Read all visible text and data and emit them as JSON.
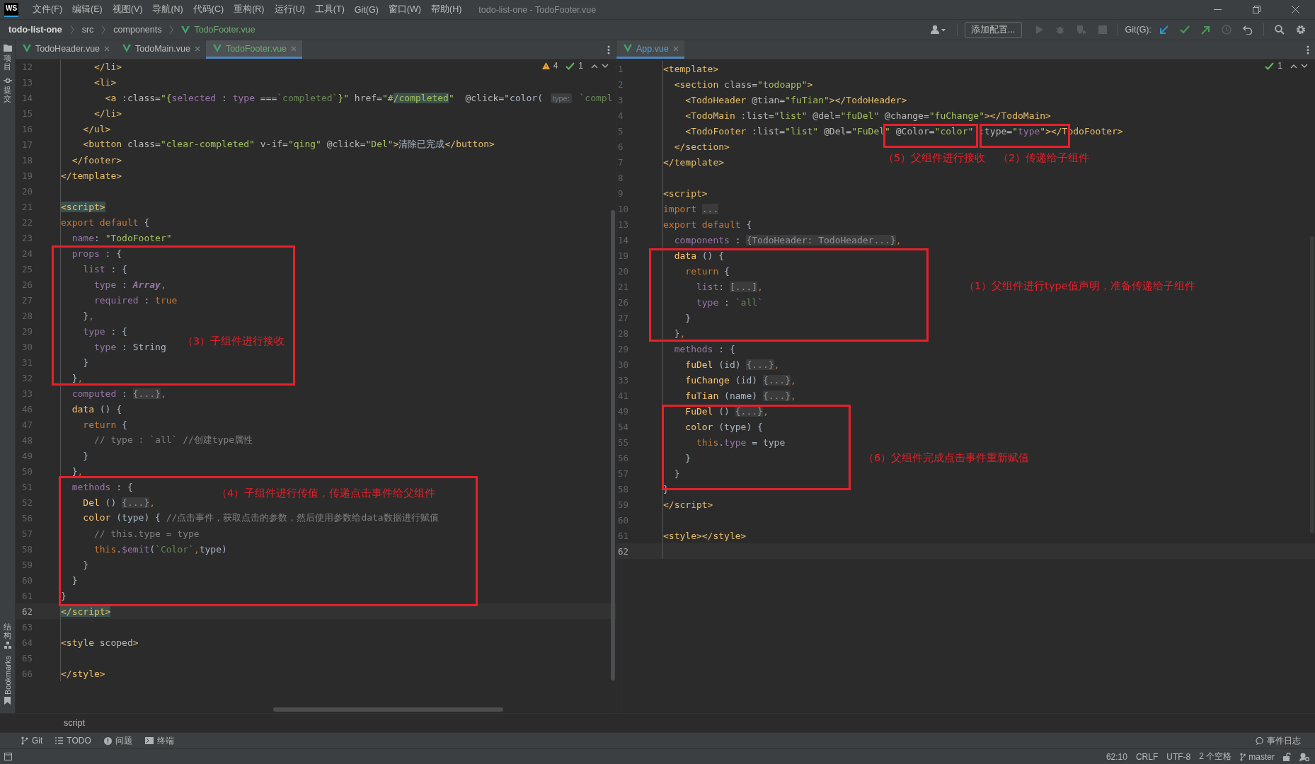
{
  "window": {
    "logo": "WS",
    "menu": [
      "文件(F)",
      "编辑(E)",
      "视图(V)",
      "导航(N)",
      "代码(C)",
      "重构(R)",
      "运行(U)",
      "工具(T)",
      "Git(G)",
      "窗口(W)",
      "帮助(H)"
    ],
    "title": "todo-list-one - TodoFooter.vue"
  },
  "breadcrumb": [
    {
      "label": "todo-list-one",
      "kind": "project"
    },
    {
      "label": "src",
      "kind": "folder"
    },
    {
      "label": "components",
      "kind": "folder"
    },
    {
      "label": "TodoFooter.vue",
      "kind": "vue"
    }
  ],
  "toolbar": {
    "config_button": "添加配置...",
    "git_label": "Git(G):"
  },
  "side_strip": {
    "top": [
      "项目",
      "提交"
    ],
    "bottom": [
      "结构"
    ],
    "bookmarks": "Bookmarks"
  },
  "left_editor": {
    "tabs": [
      {
        "label": "TodoHeader.vue",
        "selected": false
      },
      {
        "label": "TodoMain.vue",
        "selected": false
      },
      {
        "label": "TodoFooter.vue",
        "selected": true
      }
    ],
    "warnings": "4",
    "checks": "1",
    "lines": [
      {
        "n": "12",
        "current": false,
        "code": [
          {
            "kind": "tag",
            "text": "      </li>"
          }
        ]
      },
      {
        "n": "13",
        "current": false,
        "code": [
          {
            "kind": "tag",
            "text": "      <li>"
          }
        ]
      },
      {
        "n": "14",
        "current": false,
        "code": [
          {
            "kind": "tag",
            "text": "        <a"
          },
          {
            "kind": "attr",
            "text": " :class="
          },
          {
            "kind": "str",
            "text": "\"{"
          },
          {
            "kind": "prop",
            "text": "selected"
          },
          {
            "kind": "plain",
            "text": " : "
          },
          {
            "kind": "prop",
            "text": "type"
          },
          {
            "kind": "plain",
            "text": " ==="
          },
          {
            "kind": "tstr",
            "text": "`completed`"
          },
          {
            "kind": "str",
            "text": "}\""
          },
          {
            "kind": "attr",
            "text": " href="
          },
          {
            "kind": "str",
            "text": "\"#"
          },
          {
            "kind": "match",
            "text": "/completed"
          },
          {
            "kind": "str",
            "text": "\""
          },
          {
            "kind": "attr",
            "text": "  @click="
          },
          {
            "kind": "str",
            "text": "\""
          },
          {
            "kind": "plain",
            "text": "color( "
          },
          {
            "kind": "hint",
            "text": "type:"
          },
          {
            "kind": "tstr",
            "text": " `compl"
          }
        ]
      },
      {
        "n": "15",
        "current": false,
        "code": [
          {
            "kind": "tag",
            "text": "      </li>"
          }
        ]
      },
      {
        "n": "16",
        "current": false,
        "code": [
          {
            "kind": "tag",
            "text": "    </ul>"
          }
        ]
      },
      {
        "n": "17",
        "current": false,
        "code": [
          {
            "kind": "tag",
            "text": "    <button"
          },
          {
            "kind": "attr",
            "text": " class="
          },
          {
            "kind": "str",
            "text": "\"clear-completed\""
          },
          {
            "kind": "attr",
            "text": " v-if="
          },
          {
            "kind": "str",
            "text": "\"qing\""
          },
          {
            "kind": "attr",
            "text": " @click="
          },
          {
            "kind": "str",
            "text": "\"Del\""
          },
          {
            "kind": "tag",
            "text": ">"
          },
          {
            "kind": "plain",
            "text": "清除已完成"
          },
          {
            "kind": "tag",
            "text": "</button>"
          }
        ]
      },
      {
        "n": "18",
        "current": false,
        "code": [
          {
            "kind": "tag",
            "text": "  </footer>"
          }
        ]
      },
      {
        "n": "19",
        "current": false,
        "code": [
          {
            "kind": "tag",
            "text": "</template>"
          }
        ]
      },
      {
        "n": "20",
        "current": false
      },
      {
        "n": "21",
        "current": false,
        "code": [
          {
            "kind": "hl",
            "text": "<script>"
          }
        ]
      },
      {
        "n": "22",
        "current": false,
        "code": [
          {
            "kind": "kw",
            "text": "export default"
          },
          {
            "kind": "plain",
            "text": " {"
          }
        ]
      },
      {
        "n": "23",
        "current": false,
        "code": [
          {
            "kind": "prop",
            "text": "  name"
          },
          {
            "kind": "plain",
            "text": ": "
          },
          {
            "kind": "str",
            "text": "\"TodoFooter\""
          }
        ]
      },
      {
        "n": "24",
        "current": false,
        "code": [
          {
            "kind": "prop",
            "text": "  props"
          },
          {
            "kind": "plain",
            "text": " : {"
          }
        ]
      },
      {
        "n": "25",
        "current": false,
        "code": [
          {
            "kind": "prop",
            "text": "    list"
          },
          {
            "kind": "plain",
            "text": " : {"
          }
        ]
      },
      {
        "n": "26",
        "current": false,
        "code": [
          {
            "kind": "prop",
            "text": "      type"
          },
          {
            "kind": "plain",
            "text": " : "
          },
          {
            "kind": "ital",
            "text": "Array"
          },
          {
            "kind": "kw",
            "text": ","
          }
        ]
      },
      {
        "n": "27",
        "current": false,
        "code": [
          {
            "kind": "prop",
            "text": "      required"
          },
          {
            "kind": "plain",
            "text": " : "
          },
          {
            "kind": "kw",
            "text": "true"
          }
        ]
      },
      {
        "n": "28",
        "current": false,
        "code": [
          {
            "kind": "plain",
            "text": "    }"
          },
          {
            "kind": "kw",
            "text": ","
          }
        ]
      },
      {
        "n": "29",
        "current": false,
        "code": [
          {
            "kind": "prop",
            "text": "    type"
          },
          {
            "kind": "plain",
            "text": " : {"
          }
        ]
      },
      {
        "n": "30",
        "current": false,
        "code": [
          {
            "kind": "prop",
            "text": "      type"
          },
          {
            "kind": "plain",
            "text": " : String"
          }
        ]
      },
      {
        "n": "31",
        "current": false,
        "code": [
          {
            "kind": "plain",
            "text": "    }"
          }
        ]
      },
      {
        "n": "32",
        "current": false,
        "code": [
          {
            "kind": "plain",
            "text": "  }"
          },
          {
            "kind": "kw",
            "text": ","
          }
        ]
      },
      {
        "n": "33",
        "current": false,
        "code": [
          {
            "kind": "prop",
            "text": "  computed"
          },
          {
            "kind": "plain",
            "text": " : "
          },
          {
            "kind": "fold",
            "text": "{...}"
          },
          {
            "kind": "kw",
            "text": ","
          }
        ]
      },
      {
        "n": "46",
        "current": false,
        "code": [
          {
            "kind": "fn",
            "text": "  data"
          },
          {
            "kind": "plain",
            "text": " () {"
          }
        ]
      },
      {
        "n": "47",
        "current": false,
        "code": [
          {
            "kind": "kw",
            "text": "    return"
          },
          {
            "kind": "plain",
            "text": " {"
          }
        ]
      },
      {
        "n": "48",
        "current": false,
        "code": [
          {
            "kind": "cmt",
            "text": "      // type : `all` //创建type属性"
          }
        ]
      },
      {
        "n": "49",
        "current": false,
        "code": [
          {
            "kind": "plain",
            "text": "    }"
          }
        ]
      },
      {
        "n": "50",
        "current": false,
        "code": [
          {
            "kind": "plain",
            "text": "  }"
          },
          {
            "kind": "kw",
            "text": ","
          }
        ]
      },
      {
        "n": "51",
        "current": false,
        "code": [
          {
            "kind": "prop",
            "text": "  methods"
          },
          {
            "kind": "plain",
            "text": " : {"
          }
        ]
      },
      {
        "n": "52",
        "current": false,
        "code": [
          {
            "kind": "fn",
            "text": "    Del"
          },
          {
            "kind": "plain",
            "text": " () "
          },
          {
            "kind": "fold",
            "text": "{...}"
          },
          {
            "kind": "kw",
            "text": ","
          }
        ]
      },
      {
        "n": "56",
        "current": false,
        "code": [
          {
            "kind": "fn",
            "text": "    color"
          },
          {
            "kind": "plain",
            "text": " (type) { "
          },
          {
            "kind": "cmt",
            "text": "//点击事件，获取点击的参数，然后使用参数给data数据进行赋值"
          }
        ]
      },
      {
        "n": "57",
        "current": false,
        "code": [
          {
            "kind": "cmt",
            "text": "      // this.type = type"
          }
        ]
      },
      {
        "n": "58",
        "current": false,
        "code": [
          {
            "kind": "kw",
            "text": "      this"
          },
          {
            "kind": "plain",
            "text": "."
          },
          {
            "kind": "prop",
            "text": "$emit"
          },
          {
            "kind": "plain",
            "text": "("
          },
          {
            "kind": "tstr",
            "text": "`Color`"
          },
          {
            "kind": "kw",
            "text": ","
          },
          {
            "kind": "plain",
            "text": "type)"
          }
        ]
      },
      {
        "n": "59",
        "current": false,
        "code": [
          {
            "kind": "plain",
            "text": "    }"
          }
        ]
      },
      {
        "n": "60",
        "current": false,
        "code": [
          {
            "kind": "plain",
            "text": "  }"
          }
        ]
      },
      {
        "n": "61",
        "current": false,
        "code": [
          {
            "kind": "plain",
            "text": "}"
          }
        ]
      },
      {
        "n": "62",
        "current": true,
        "code": [
          {
            "kind": "hl",
            "text": "</script>"
          }
        ]
      },
      {
        "n": "63",
        "current": false
      },
      {
        "n": "64",
        "current": false,
        "code": [
          {
            "kind": "tag",
            "text": "<style"
          },
          {
            "kind": "attr",
            "text": " scoped"
          },
          {
            "kind": "tag",
            "text": ">"
          }
        ]
      },
      {
        "n": "65",
        "current": false
      },
      {
        "n": "66",
        "current": false,
        "code": [
          {
            "kind": "tag",
            "text": "</style>"
          }
        ]
      }
    ],
    "annotations": [
      {
        "text": "（3）子组件进行接收"
      },
      {
        "text": "（4）子组件进行传值，传递点击事件给父组件"
      }
    ]
  },
  "right_editor": {
    "tabs": [
      {
        "label": "App.vue",
        "selected": true
      }
    ],
    "checks": "1",
    "lines": [
      {
        "n": "1",
        "current": false,
        "code": [
          {
            "kind": "tag",
            "text": "<template>"
          }
        ]
      },
      {
        "n": "2",
        "current": false,
        "code": [
          {
            "kind": "tag",
            "text": "  <section"
          },
          {
            "kind": "attr",
            "text": " class="
          },
          {
            "kind": "str",
            "text": "\"todoapp\""
          },
          {
            "kind": "tag",
            "text": ">"
          }
        ]
      },
      {
        "n": "3",
        "current": false,
        "code": [
          {
            "kind": "tag",
            "text": "    <TodoHeader"
          },
          {
            "kind": "attr",
            "text": " @tian="
          },
          {
            "kind": "str",
            "text": "\"fuTian\""
          },
          {
            "kind": "tag",
            "text": "></TodoHeader>"
          }
        ]
      },
      {
        "n": "4",
        "current": false,
        "code": [
          {
            "kind": "tag",
            "text": "    <TodoMain"
          },
          {
            "kind": "attr",
            "text": " :list="
          },
          {
            "kind": "str",
            "text": "\"list\""
          },
          {
            "kind": "attr",
            "text": " @del="
          },
          {
            "kind": "str",
            "text": "\"fuDel\""
          },
          {
            "kind": "attr",
            "text": " @change="
          },
          {
            "kind": "str",
            "text": "\"fuChange\""
          },
          {
            "kind": "tag",
            "text": "></TodoMain>"
          }
        ]
      },
      {
        "n": "5",
        "current": false,
        "code": [
          {
            "kind": "tag",
            "text": "    <TodoFooter"
          },
          {
            "kind": "attr",
            "text": " :list="
          },
          {
            "kind": "str",
            "text": "\"list\""
          },
          {
            "kind": "attr",
            "text": " @Del="
          },
          {
            "kind": "str",
            "text": "\"FuDel\""
          },
          {
            "kind": "attr",
            "text": " @Color="
          },
          {
            "kind": "str",
            "text": "\"color\""
          },
          {
            "kind": "attr",
            "text": " :type="
          },
          {
            "kind": "str",
            "text": "\""
          },
          {
            "kind": "prop",
            "text": "type"
          },
          {
            "kind": "str",
            "text": "\""
          },
          {
            "kind": "tag",
            "text": "></TodoFooter>"
          }
        ]
      },
      {
        "n": "6",
        "current": false,
        "code": [
          {
            "kind": "tag",
            "text": "  </section>"
          }
        ]
      },
      {
        "n": "7",
        "current": false,
        "code": [
          {
            "kind": "tag",
            "text": "</template>"
          }
        ]
      },
      {
        "n": "8",
        "current": false
      },
      {
        "n": "9",
        "current": false,
        "code": [
          {
            "kind": "tag",
            "text": "<script>"
          }
        ]
      },
      {
        "n": "10",
        "current": false,
        "code": [
          {
            "kind": "kw",
            "text": "import "
          },
          {
            "kind": "fold",
            "text": "..."
          }
        ]
      },
      {
        "n": "13",
        "current": false,
        "code": [
          {
            "kind": "kw",
            "text": "export default"
          },
          {
            "kind": "plain",
            "text": " {"
          }
        ]
      },
      {
        "n": "14",
        "current": false,
        "code": [
          {
            "kind": "prop",
            "text": "  components"
          },
          {
            "kind": "plain",
            "text": " : "
          },
          {
            "kind": "fold",
            "text": "{TodoHeader: TodoHeader...}"
          },
          {
            "kind": "kw",
            "text": ","
          }
        ]
      },
      {
        "n": "19",
        "current": false,
        "code": [
          {
            "kind": "fn",
            "text": "  data"
          },
          {
            "kind": "plain",
            "text": " () {"
          }
        ]
      },
      {
        "n": "20",
        "current": false,
        "code": [
          {
            "kind": "kw",
            "text": "    return"
          },
          {
            "kind": "plain",
            "text": " {"
          }
        ]
      },
      {
        "n": "21",
        "current": false,
        "code": [
          {
            "kind": "prop",
            "text": "      list"
          },
          {
            "kind": "plain",
            "text": ": "
          },
          {
            "kind": "fold",
            "text": "[...]"
          },
          {
            "kind": "kw",
            "text": ","
          }
        ]
      },
      {
        "n": "26",
        "current": false,
        "code": [
          {
            "kind": "prop",
            "text": "      type"
          },
          {
            "kind": "plain",
            "text": " : "
          },
          {
            "kind": "tstr",
            "text": "`all`"
          }
        ]
      },
      {
        "n": "27",
        "current": false,
        "code": [
          {
            "kind": "plain",
            "text": "    }"
          }
        ]
      },
      {
        "n": "28",
        "current": false,
        "code": [
          {
            "kind": "plain",
            "text": "  }"
          },
          {
            "kind": "kw",
            "text": ","
          }
        ]
      },
      {
        "n": "29",
        "current": false,
        "code": [
          {
            "kind": "prop",
            "text": "  methods"
          },
          {
            "kind": "plain",
            "text": " : {"
          }
        ]
      },
      {
        "n": "30",
        "current": false,
        "code": [
          {
            "kind": "fn",
            "text": "    fuDel"
          },
          {
            "kind": "plain",
            "text": " (id) "
          },
          {
            "kind": "fold",
            "text": "{...}"
          },
          {
            "kind": "kw",
            "text": ","
          }
        ]
      },
      {
        "n": "33",
        "current": false,
        "code": [
          {
            "kind": "fn",
            "text": "    fuChange"
          },
          {
            "kind": "plain",
            "text": " (id) "
          },
          {
            "kind": "fold",
            "text": "{...}"
          },
          {
            "kind": "kw",
            "text": ","
          }
        ]
      },
      {
        "n": "41",
        "current": false,
        "code": [
          {
            "kind": "fn",
            "text": "    fuTian"
          },
          {
            "kind": "plain",
            "text": " (name) "
          },
          {
            "kind": "fold",
            "text": "{...}"
          },
          {
            "kind": "kw",
            "text": ","
          }
        ]
      },
      {
        "n": "49",
        "current": false,
        "code": [
          {
            "kind": "fn",
            "text": "    FuDel"
          },
          {
            "kind": "plain",
            "text": " () "
          },
          {
            "kind": "fold",
            "text": "{...}"
          },
          {
            "kind": "kw",
            "text": ","
          }
        ]
      },
      {
        "n": "54",
        "current": false,
        "code": [
          {
            "kind": "fn",
            "text": "    color"
          },
          {
            "kind": "plain",
            "text": " (type) {"
          }
        ]
      },
      {
        "n": "55",
        "current": false,
        "code": [
          {
            "kind": "kw",
            "text": "      this"
          },
          {
            "kind": "plain",
            "text": "."
          },
          {
            "kind": "prop",
            "text": "type"
          },
          {
            "kind": "plain",
            "text": " = type"
          }
        ]
      },
      {
        "n": "56",
        "current": false,
        "code": [
          {
            "kind": "plain",
            "text": "    }"
          }
        ]
      },
      {
        "n": "57",
        "current": false,
        "code": [
          {
            "kind": "plain",
            "text": "  }"
          }
        ]
      },
      {
        "n": "58",
        "current": false,
        "code": [
          {
            "kind": "plain",
            "text": "}"
          }
        ]
      },
      {
        "n": "59",
        "current": false,
        "code": [
          {
            "kind": "tag",
            "text": "</script>"
          }
        ]
      },
      {
        "n": "60",
        "current": false
      },
      {
        "n": "61",
        "current": false,
        "code": [
          {
            "kind": "tag",
            "text": "<style></style>"
          }
        ]
      },
      {
        "n": "62",
        "current": true
      }
    ],
    "annotations": [
      {
        "text": "（5）父组件进行接收"
      },
      {
        "text": "（2）传递给子组件"
      },
      {
        "text": "（1）父组件进行type值声明，准备传递给子组件"
      },
      {
        "text": "（6）父组件完成点击事件重新赋值"
      }
    ]
  },
  "code_breadcrumb": "script",
  "tool_windows": [
    "Git",
    "TODO",
    "问题",
    "终端"
  ],
  "event_log": "事件日志",
  "status_bar": {
    "position": "62:10",
    "line_ending": "CRLF",
    "encoding": "UTF-8",
    "indent": "2 个空格",
    "branch": "master"
  }
}
